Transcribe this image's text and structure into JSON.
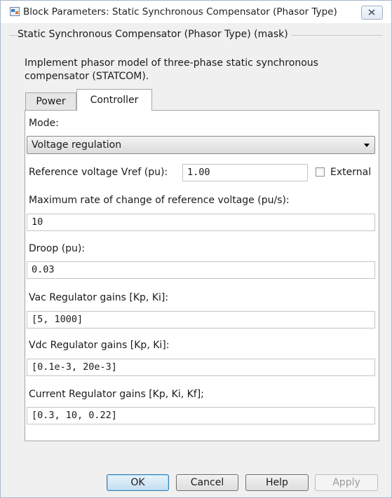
{
  "window": {
    "title": "Block Parameters: Static Synchronous Compensator (Phasor Type)"
  },
  "group": {
    "title": "Static Synchronous Compensator (Phasor Type) (mask)",
    "description": "Implement phasor model of three-phase static synchronous compensator (STATCOM)."
  },
  "tabs": [
    {
      "label": "Power",
      "active": false
    },
    {
      "label": "Controller",
      "active": true
    }
  ],
  "controller": {
    "mode_label": "Mode:",
    "mode_value": "Voltage regulation",
    "vref_label": "Reference voltage Vref (pu):",
    "vref_value": "1.00",
    "external_label": "External",
    "external_checked": false,
    "max_rate_label": "Maximum rate of change of reference voltage (pu/s):",
    "max_rate_value": "10",
    "droop_label": "Droop (pu):",
    "droop_value": "0.03",
    "vac_label": "Vac Regulator gains [Kp, Ki]:",
    "vac_value": "[5, 1000]",
    "vdc_label": "Vdc Regulator gains [Kp, Ki]:",
    "vdc_value": "[0.1e-3, 20e-3]",
    "current_label": "Current Regulator gains [Kp, Ki, Kf];",
    "current_value": "[0.3, 10, 0.22]"
  },
  "buttons": {
    "ok": "OK",
    "cancel": "Cancel",
    "help": "Help",
    "apply": "Apply"
  },
  "icons": {
    "app": "simulink-block-icon",
    "close": "close-icon",
    "dropdown": "chevron-down-icon"
  }
}
